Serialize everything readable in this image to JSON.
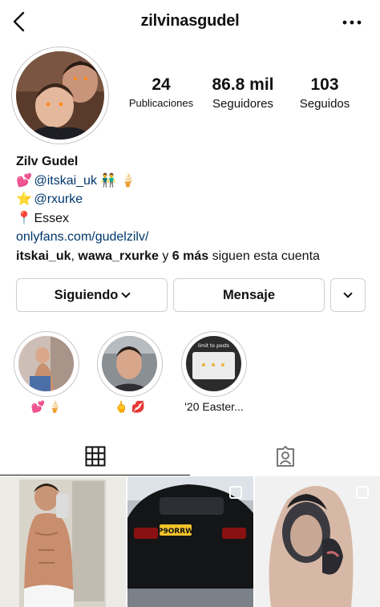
{
  "header": {
    "username": "zilvinasgudel"
  },
  "stats": {
    "posts_count": "24",
    "posts_label": "Publicaciones",
    "followers_count": "86.8 mil",
    "followers_label": "Seguidores",
    "following_count": "103",
    "following_label": "Seguidos"
  },
  "bio": {
    "name": "Zilv Gudel",
    "line1_emoji": "💕",
    "line1_mention": "@itskai_uk",
    "line1_suffix": "👬 🍦",
    "line2_emoji": "⭐",
    "line2_mention": "@rxurke",
    "line3_emoji": "📍",
    "line3_text": "Essex",
    "link": "onlyfans.com/gudelzilv/",
    "followed_user1": "itskai_uk",
    "followed_sep1": ", ",
    "followed_user2": "wawa_rxurke",
    "followed_mid": " y ",
    "followed_more": "6 más",
    "followed_suffix": " siguen esta cuenta"
  },
  "actions": {
    "following_label": "Siguiendo",
    "message_label": "Mensaje"
  },
  "highlights": [
    {
      "label": "💕 🍦"
    },
    {
      "label": "🖕 💋"
    },
    {
      "label": "'20 Easter..."
    }
  ],
  "highlight3_inner_text": "limit to posts",
  "post2_plate": "P9ORRW",
  "colors": {
    "link": "#00376b",
    "border": "#cfcfcf",
    "text": "#111111"
  }
}
